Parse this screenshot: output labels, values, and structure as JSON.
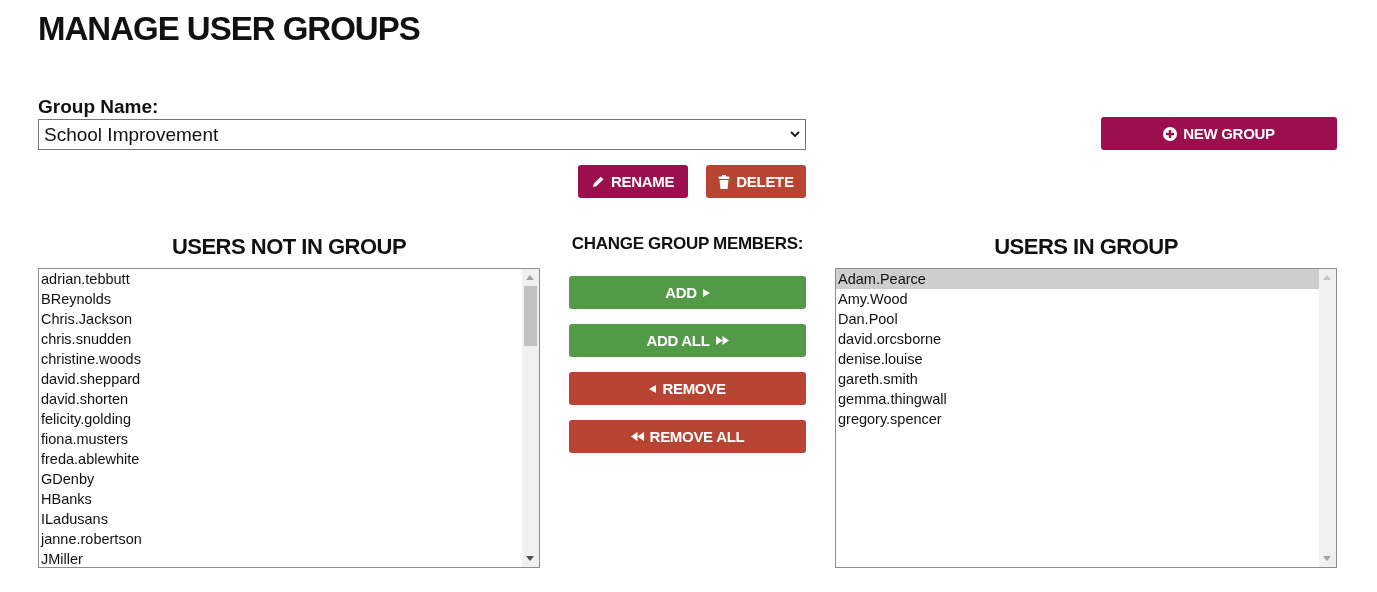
{
  "title": "MANAGE USER GROUPS",
  "group_name": {
    "label": "Group Name:",
    "value": "School Improvement"
  },
  "new_group_button": "NEW GROUP",
  "group_actions": [
    {
      "label": "RENAME",
      "kind": "rename"
    },
    {
      "label": "DELETE",
      "kind": "delete"
    }
  ],
  "users_not_in_group": {
    "heading": "USERS NOT IN GROUP",
    "items": [
      {
        "label": "adrian.tebbutt",
        "selected": false
      },
      {
        "label": "BReynolds",
        "selected": false
      },
      {
        "label": "Chris.Jackson",
        "selected": false
      },
      {
        "label": "chris.snudden",
        "selected": false
      },
      {
        "label": "christine.woods",
        "selected": false
      },
      {
        "label": "david.sheppard",
        "selected": false
      },
      {
        "label": "david.shorten",
        "selected": false
      },
      {
        "label": "felicity.golding",
        "selected": false
      },
      {
        "label": "fiona.musters",
        "selected": false
      },
      {
        "label": "freda.ablewhite",
        "selected": false
      },
      {
        "label": "GDenby",
        "selected": false
      },
      {
        "label": "HBanks",
        "selected": false
      },
      {
        "label": "ILadusans",
        "selected": false
      },
      {
        "label": "janne.robertson",
        "selected": false
      },
      {
        "label": "JMiller",
        "selected": false
      }
    ]
  },
  "change_members": {
    "heading": "CHANGE GROUP MEMBERS:",
    "buttons": [
      {
        "label": "ADD",
        "kind": "add"
      },
      {
        "label": "ADD ALL",
        "kind": "add_all"
      },
      {
        "label": "REMOVE",
        "kind": "remove"
      },
      {
        "label": "REMOVE ALL",
        "kind": "remove_all"
      }
    ]
  },
  "users_in_group": {
    "heading": "USERS IN GROUP",
    "items": [
      {
        "label": "Adam.Pearce",
        "selected": true
      },
      {
        "label": "Amy.Wood",
        "selected": false
      },
      {
        "label": "Dan.Pool",
        "selected": false
      },
      {
        "label": "david.orcsborne",
        "selected": false
      },
      {
        "label": "denise.louise",
        "selected": false
      },
      {
        "label": "gareth.smith",
        "selected": false
      },
      {
        "label": "gemma.thingwall",
        "selected": false
      },
      {
        "label": "gregory.spencer",
        "selected": false
      }
    ]
  }
}
